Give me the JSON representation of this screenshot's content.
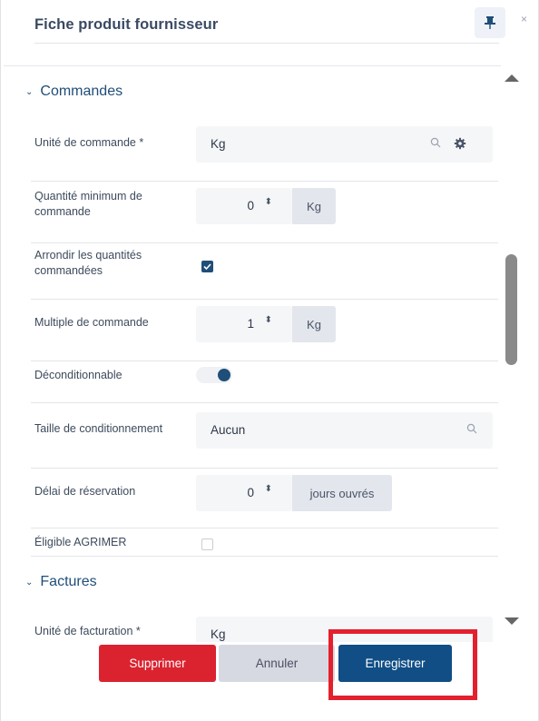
{
  "header": {
    "title": "Fiche produit fournisseur",
    "close_label": "×"
  },
  "icons": {
    "pin": "pin-icon",
    "close": "close-icon",
    "search": "search-icon",
    "gear": "gear-icon",
    "chevron": "chevron-down-icon"
  },
  "colors": {
    "primary": "#104e85",
    "danger": "#db2330",
    "highlight": "#e4202e"
  },
  "sections": {
    "commandes": {
      "title": "Commandes",
      "chevron": "⌄"
    },
    "factures": {
      "title": "Factures",
      "chevron": "⌄"
    }
  },
  "fields": {
    "unite_commande": {
      "label": "Unité de commande *",
      "value": "Kg"
    },
    "quantite_min": {
      "label": "Quantité minimum de commande",
      "value": "0",
      "unit": "Kg",
      "spinner": "⬍"
    },
    "arrondir": {
      "label": "Arrondir les quantités commandées",
      "checked": true
    },
    "multiple": {
      "label": "Multiple de commande",
      "value": "1",
      "unit": "Kg",
      "spinner": "⬍"
    },
    "deconditionnable": {
      "label": "Déconditionnable",
      "on": true
    },
    "taille": {
      "label": "Taille de conditionnement",
      "value": "Aucun"
    },
    "delai": {
      "label": "Délai de réservation",
      "value": "0",
      "unit": "jours ouvrés",
      "spinner": "⬍"
    },
    "agrimer": {
      "label": "Éligible AGRIMER",
      "checked": false
    },
    "unite_facturation": {
      "label": "Unité de facturation *",
      "value": "Kg"
    }
  },
  "footer": {
    "delete_label": "Supprimer",
    "cancel_label": "Annuler",
    "save_label": "Enregistrer"
  }
}
